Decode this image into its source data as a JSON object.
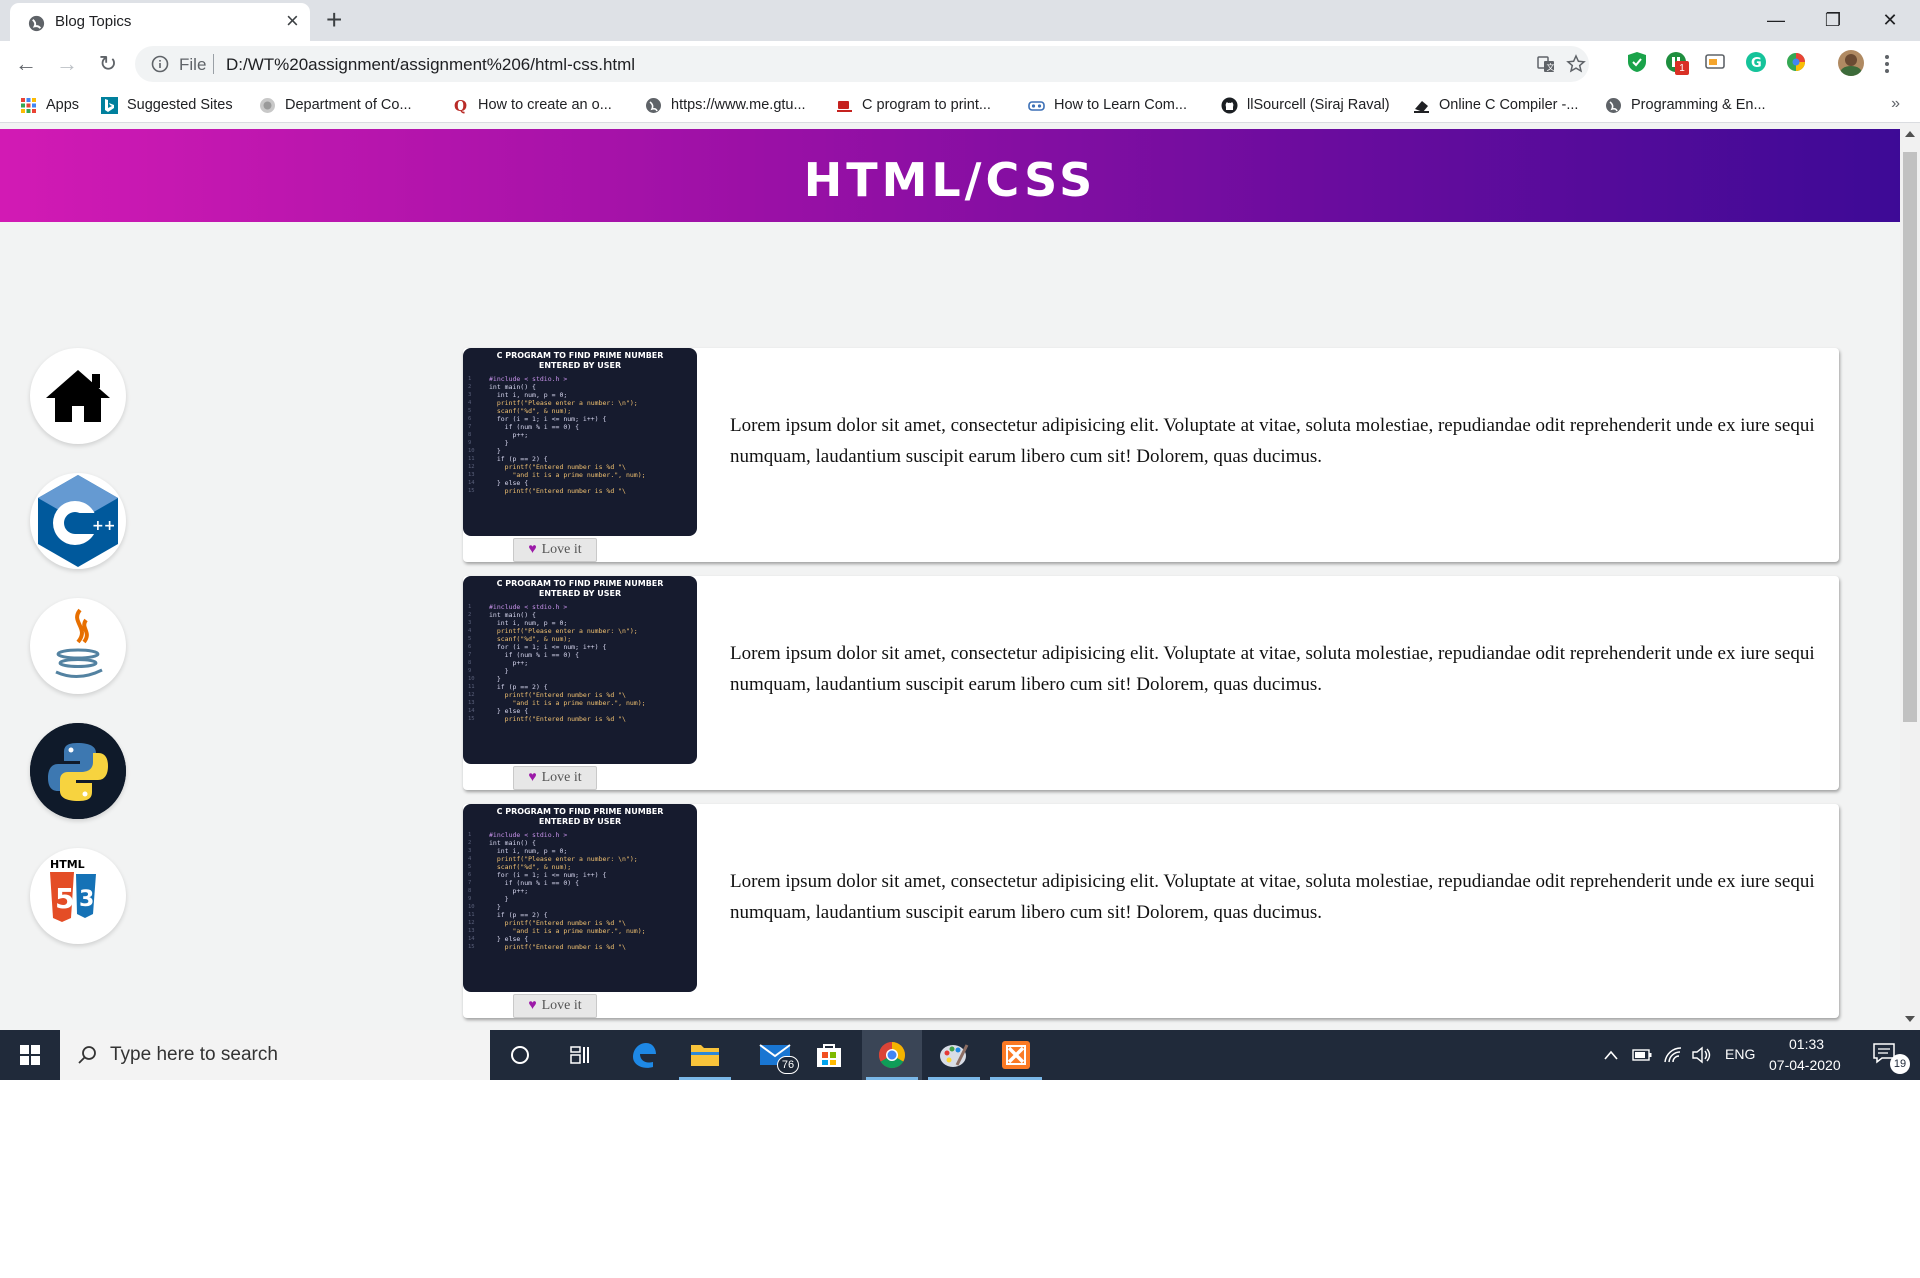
{
  "browser": {
    "tab_title": "Blog Topics",
    "tab_close": "×",
    "new_tab": "+",
    "window_controls": {
      "minimize": "—",
      "restore": "❐",
      "close": "✕"
    },
    "nav": {
      "back": "←",
      "forward": "→",
      "reload": "↻"
    },
    "scheme_label": "File",
    "url": "D:/WT%20assignment/assignment%206/html-css.html",
    "extension_badge": "1",
    "bookmarks": [
      {
        "label": "Apps",
        "icon": "apps-grid-icon"
      },
      {
        "label": "Suggested Sites",
        "icon": "bing-icon"
      },
      {
        "label": "Department of Co...",
        "icon": "globe-seal-icon"
      },
      {
        "label": "How to create an o...",
        "icon": "quora-icon"
      },
      {
        "label": "https://www.me.gtu...",
        "icon": "globe-icon"
      },
      {
        "label": "C program to print...",
        "icon": "cup-icon"
      },
      {
        "label": "How to Learn Com...",
        "icon": "robot-icon"
      },
      {
        "label": "llSourcell (Siraj Raval)",
        "icon": "github-icon"
      },
      {
        "label": "Online C Compiler -...",
        "icon": "compiler-icon"
      },
      {
        "label": "Programming & En...",
        "icon": "globe-icon"
      }
    ],
    "bookmarks_more": "»"
  },
  "page": {
    "banner_title": "HTML/CSS",
    "colors": {
      "banner_start": "#d21ab4",
      "banner_end": "#3d0a96",
      "heart": "#9c1aa8"
    },
    "side_nav": [
      {
        "name": "home",
        "icon": "home-icon"
      },
      {
        "name": "cpp",
        "icon": "cpp-icon"
      },
      {
        "name": "java",
        "icon": "java-icon"
      },
      {
        "name": "python",
        "icon": "python-icon"
      },
      {
        "name": "html-css",
        "icon": "html5-css3-icon"
      }
    ],
    "thumb": {
      "title_line1": "C PROGRAM TO FIND PRIME NUMBER",
      "title_line2": "ENTERED BY USER",
      "line_numbers": "1\n2\n3\n4\n5\n6\n7\n8\n9\n10\n11\n12\n13\n14\n15",
      "code": [
        "#include < stdio.h >",
        "int main() {",
        "  int i, num, p = 0;",
        "  printf(\"Please enter a number: \\n\");",
        "  scanf(\"%d\", & num);",
        "  for (i = 1; i <= num; i++) {",
        "    if (num % i == 0) {",
        "      p++;",
        "    }",
        "  }",
        "  if (p == 2) {",
        "    printf(\"Entered number is %d \"\\",
        "      \"and it is a prime number.\", num);",
        "  } else {",
        "    printf(\"Entered number is %d \"\\"
      ]
    },
    "cards": [
      {
        "love_label": "Love it",
        "heart": "♥",
        "text": "Lorem ipsum dolor sit amet, consectetur adipisicing elit. Voluptate at vitae, soluta molestiae, repudiandae odit reprehenderit unde ex iure sequi numquam, laudantium suscipit earum libero cum sit! Dolorem, quas ducimus."
      },
      {
        "love_label": "Love it",
        "heart": "♥",
        "text": "Lorem ipsum dolor sit amet, consectetur adipisicing elit. Voluptate at vitae, soluta molestiae, repudiandae odit reprehenderit unde ex iure sequi numquam, laudantium suscipit earum libero cum sit! Dolorem, quas ducimus."
      },
      {
        "love_label": "Love it",
        "heart": "♥",
        "text": "Lorem ipsum dolor sit amet, consectetur adipisicing elit. Voluptate at vitae, soluta molestiae, repudiandae odit reprehenderit unde ex iure sequi numquam, laudantium suscipit earum libero cum sit! Dolorem, quas ducimus."
      }
    ]
  },
  "taskbar": {
    "search_placeholder": "Type here to search",
    "mail_badge": "76",
    "language": "ENG",
    "time": "01:33",
    "date": "07-04-2020",
    "notification_count": "19"
  }
}
